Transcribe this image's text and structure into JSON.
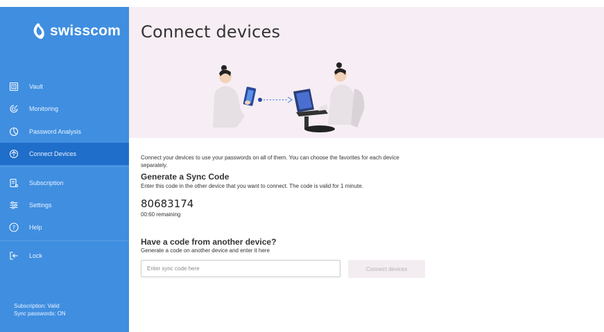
{
  "brand": {
    "name": "swisscom",
    "logo_icon": "swisscom-logo-icon",
    "accent": "#3f8ee0",
    "active": "#1f6ec9"
  },
  "sidebar": {
    "items": [
      {
        "label": "Vault",
        "icon": "vault-icon"
      },
      {
        "label": "Monitoring",
        "icon": "monitoring-icon"
      },
      {
        "label": "Password Analysis",
        "icon": "password-analysis-icon"
      },
      {
        "label": "Connect Devices",
        "icon": "connect-devices-icon",
        "active": true
      },
      {
        "label": "Subscription",
        "icon": "subscription-icon"
      },
      {
        "label": "Settings",
        "icon": "settings-icon"
      },
      {
        "label": "Help",
        "icon": "help-icon"
      },
      {
        "label": "Lock",
        "icon": "lock-icon"
      }
    ],
    "status": {
      "subscription": "Subscription: Valid",
      "sync": "Sync passwords: ON"
    }
  },
  "main": {
    "title": "Connect devices",
    "intro": "Connect your devices to use your passwords on all of them. You can choose the favorites for each device separately.",
    "generate": {
      "heading": "Generate a Sync Code",
      "description": "Enter this code in the other device that you want to connect. The code is valid for 1 minute.",
      "code": "80683174",
      "remaining": "00:60 remaining"
    },
    "have_code": {
      "heading": "Have a code from another device?",
      "description": "Generate a code on another device and enter it here",
      "input_placeholder": "Enter sync code here",
      "input_value": "",
      "button_label": "Connect devices"
    }
  }
}
